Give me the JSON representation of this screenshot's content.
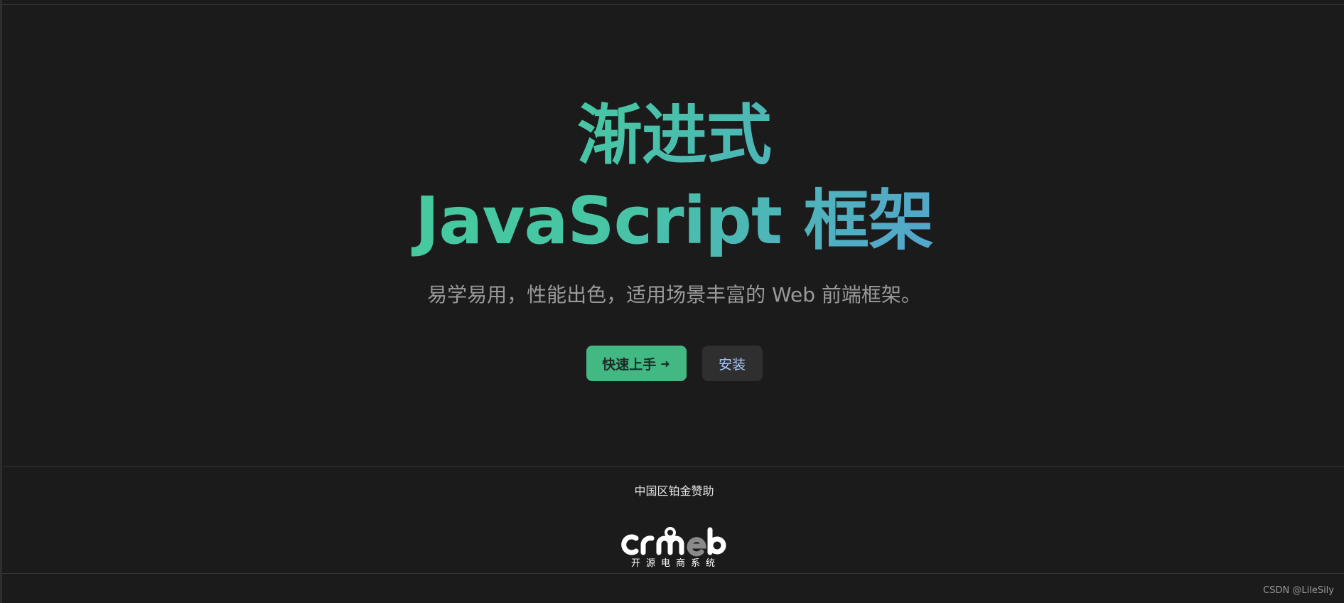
{
  "hero": {
    "title_line_1": "渐进式",
    "title_line_2": "JavaScript 框架",
    "subtitle": "易学易用，性能出色，适用场景丰富的 Web 前端框架。",
    "gradient_colors": [
      "#42d392",
      "#647eff"
    ]
  },
  "actions": {
    "primary_label": "快速上手",
    "primary_icon": "arrow-right-icon",
    "secondary_label": "安装",
    "primary_color": "#42b883"
  },
  "sponsor": {
    "title": "中国区铂金赞助",
    "logo_wordmark": "crmeb",
    "logo_tagline": "开源电商系统"
  },
  "watermark": "CSDN @LileSily"
}
